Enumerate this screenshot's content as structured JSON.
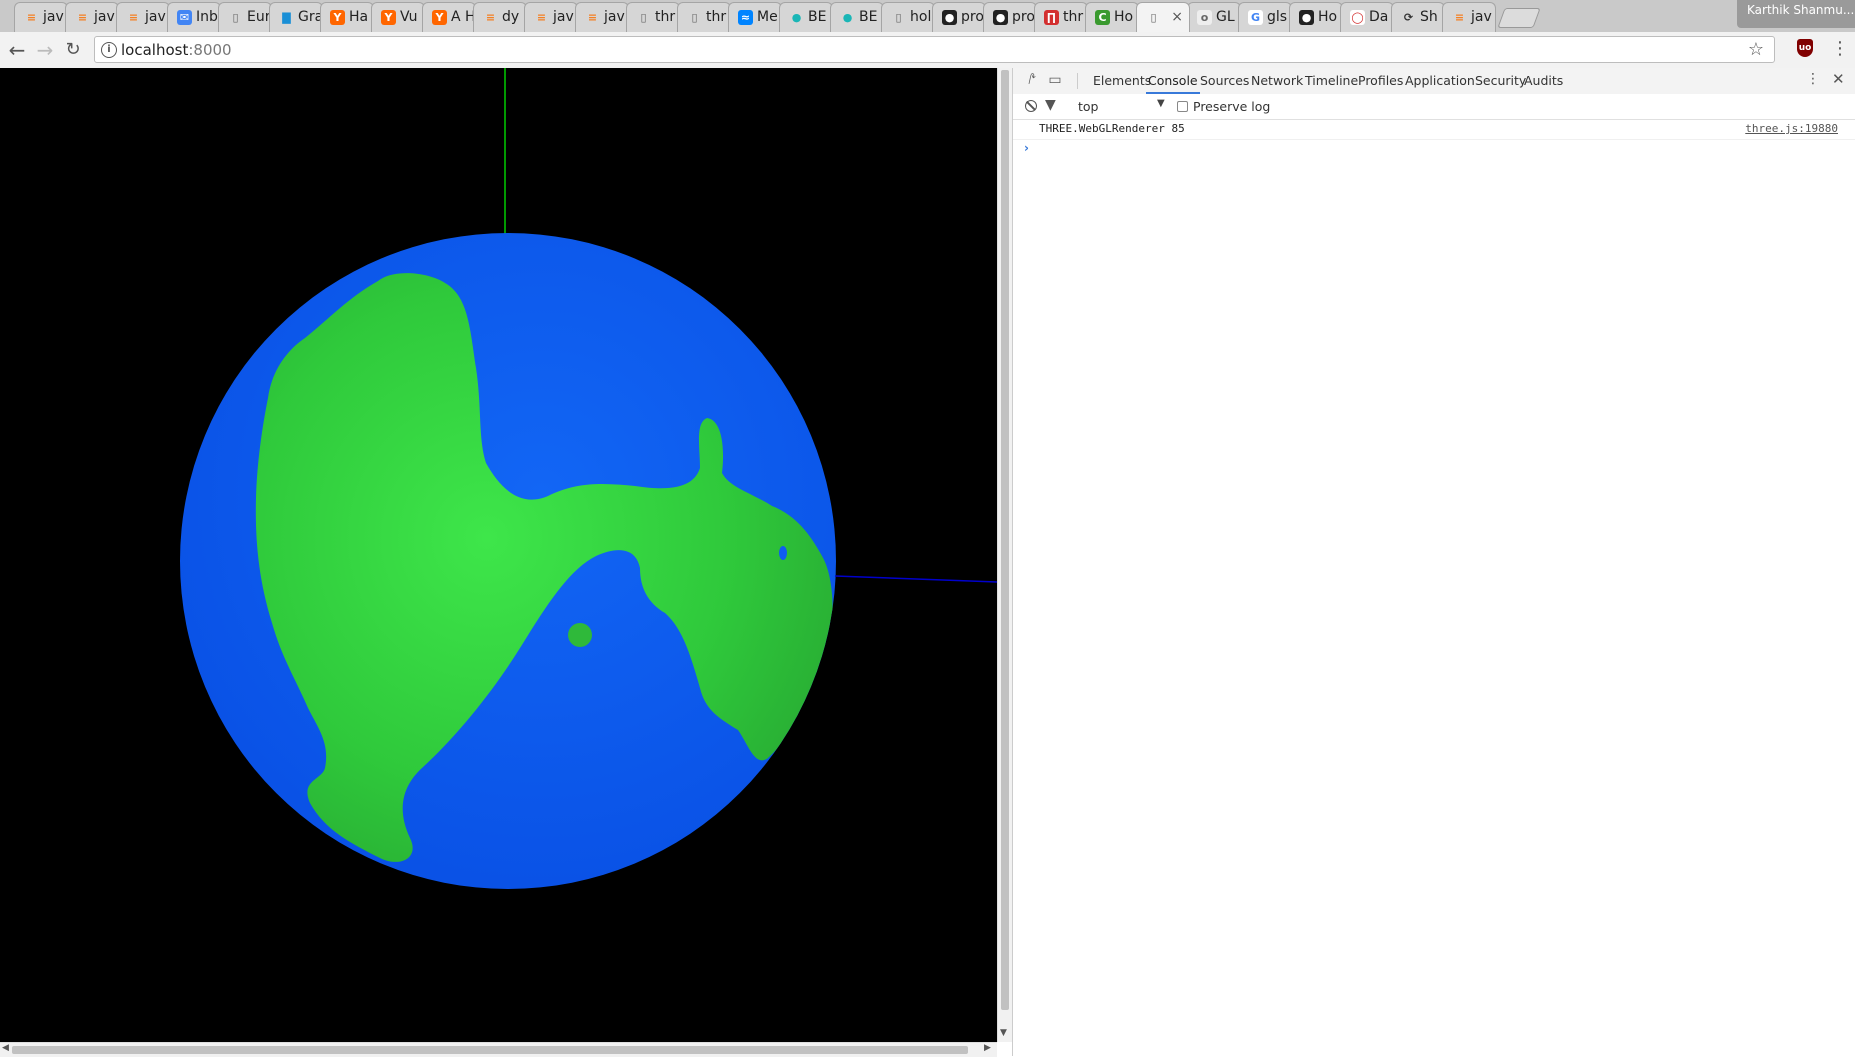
{
  "browser": {
    "tabs": [
      {
        "label": "jav",
        "icon": "stackoverflow-icon"
      },
      {
        "label": "jav",
        "icon": "stackoverflow-icon"
      },
      {
        "label": "jav",
        "icon": "stackoverflow-icon"
      },
      {
        "label": "Inb",
        "icon": "inbox-icon"
      },
      {
        "label": "Eur",
        "icon": "page-icon"
      },
      {
        "label": "Gra",
        "icon": "chart-icon"
      },
      {
        "label": "Ha",
        "icon": "hackernews-icon"
      },
      {
        "label": "Vu",
        "icon": "hackernews-icon"
      },
      {
        "label": "A H",
        "icon": "hackernews-icon"
      },
      {
        "label": "dy",
        "icon": "stackoverflow-icon"
      },
      {
        "label": "jav",
        "icon": "stackoverflow-icon"
      },
      {
        "label": "jav",
        "icon": "stackoverflow-icon"
      },
      {
        "label": "thr",
        "icon": "page-icon"
      },
      {
        "label": "thr",
        "icon": "page-icon"
      },
      {
        "label": "Me",
        "icon": "messenger-icon"
      },
      {
        "label": "BE",
        "icon": "dot-icon"
      },
      {
        "label": "BE",
        "icon": "dot-icon"
      },
      {
        "label": "hol",
        "icon": "page-icon"
      },
      {
        "label": "pro",
        "icon": "github-icon"
      },
      {
        "label": "pro",
        "icon": "github-icon"
      },
      {
        "label": "thr",
        "icon": "red-square-icon"
      },
      {
        "label": "Ho",
        "icon": "green-c-icon"
      },
      {
        "label": "",
        "icon": "page-icon",
        "active": true
      },
      {
        "label": "GL",
        "icon": "ogl-icon"
      },
      {
        "label": "gls",
        "icon": "google-icon"
      },
      {
        "label": "Ho",
        "icon": "github-icon"
      },
      {
        "label": "Da",
        "icon": "oracle-icon"
      },
      {
        "label": "Sh",
        "icon": "share-icon"
      },
      {
        "label": "jav",
        "icon": "stackoverflow-icon"
      }
    ],
    "profile_name": "Karthik Shanmu...",
    "url_host": "localhost",
    "url_port": ":8000"
  },
  "scene": {
    "background": "#000000",
    "ocean_color": "#0f5cf0",
    "land_color": "#33d63f",
    "axis_y_color": "#00cc00",
    "axis_x_color": "#0000cc"
  },
  "devtools": {
    "tabs": [
      {
        "label": "Elements"
      },
      {
        "label": "Console",
        "active": true
      },
      {
        "label": "Sources"
      },
      {
        "label": "Network"
      },
      {
        "label": "Timeline"
      },
      {
        "label": "Profiles"
      },
      {
        "label": "Application"
      },
      {
        "label": "Security"
      },
      {
        "label": "Audits"
      }
    ],
    "context": "top",
    "preserve_log_label": "Preserve log",
    "console_message": "THREE.WebGLRenderer 85",
    "console_source": "three.js:19880",
    "prompt_symbol": "›"
  }
}
